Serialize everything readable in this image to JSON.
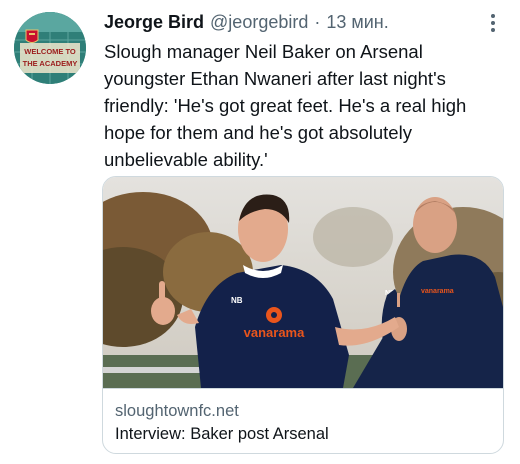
{
  "tweet": {
    "author_name": "Jeorge Bird",
    "author_handle": "@jeorgebird",
    "separator": "·",
    "timestamp": "13 мин.",
    "text": "Slough manager Neil Baker on Arsenal youngster Ethan Nwaneri after last night's friendly: 'He's got great feet. He's a real high hope for them and he's got absolutely unbelievable ability.'",
    "more_icon": "more-vertical-icon"
  },
  "avatar": {
    "sign_line1": "WELCOME TO",
    "sign_line2": "THE ACADEMY"
  },
  "card": {
    "domain": "sloughtownfc.net",
    "title": "Interview: Baker post Arsenal",
    "shirt_sponsor": "vanarama"
  },
  "colors": {
    "text_primary": "#0f1419",
    "text_secondary": "#536471",
    "border": "#cfd9de",
    "shirt_navy": "#13214a",
    "sponsor_orange": "#e9551c"
  }
}
